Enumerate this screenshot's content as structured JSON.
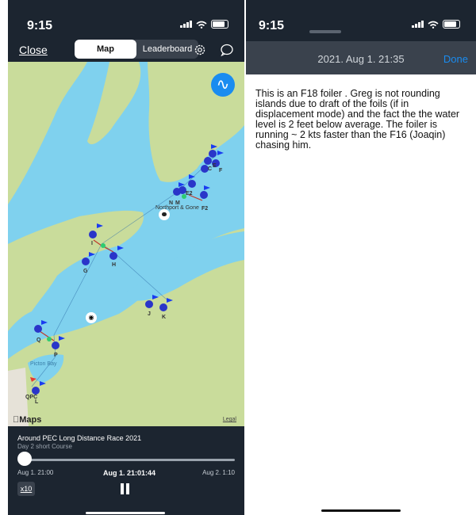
{
  "left": {
    "status": {
      "time": "9:15"
    },
    "nav": {
      "close": "Close",
      "tabs": [
        {
          "label": "Map",
          "active": true
        },
        {
          "label": "Leaderboard",
          "active": false
        }
      ]
    },
    "map": {
      "marks": [
        "C",
        "E",
        "F",
        "E2",
        "F2",
        "N",
        "M",
        "Northport & Gone",
        "I",
        "G",
        "H",
        "J",
        "K",
        "Q",
        "P",
        "QPC",
        "L"
      ],
      "water_label": "Picton Bay",
      "attribution": "Maps",
      "legal": "Legal"
    },
    "playback": {
      "title": "Around PEC Long Distance Race 2021",
      "subtitle": "Day 2 short Course",
      "start": "Aug 1. 21:00",
      "current": "Aug 1. 21:01:44",
      "end": "Aug 2. 1:10",
      "speed": "x10",
      "progress": 0.01
    }
  },
  "right": {
    "status": {
      "time": "9:15"
    },
    "header": {
      "title": "2021. Aug 1. 21:35",
      "done": "Done"
    },
    "note": "This is an F18 foiler .  Greg is not rounding islands due to  draft of the foils (if in displacement mode)  and the fact the the water level is 2 feet below average.   The foiler is running ~ 2 kts faster than the F16 (Joaqin) chasing him."
  },
  "colors": {
    "water": "#7fd1ee",
    "land": "#c9dc9b",
    "accent": "#1a8cf0",
    "dark": "#1c2530"
  }
}
